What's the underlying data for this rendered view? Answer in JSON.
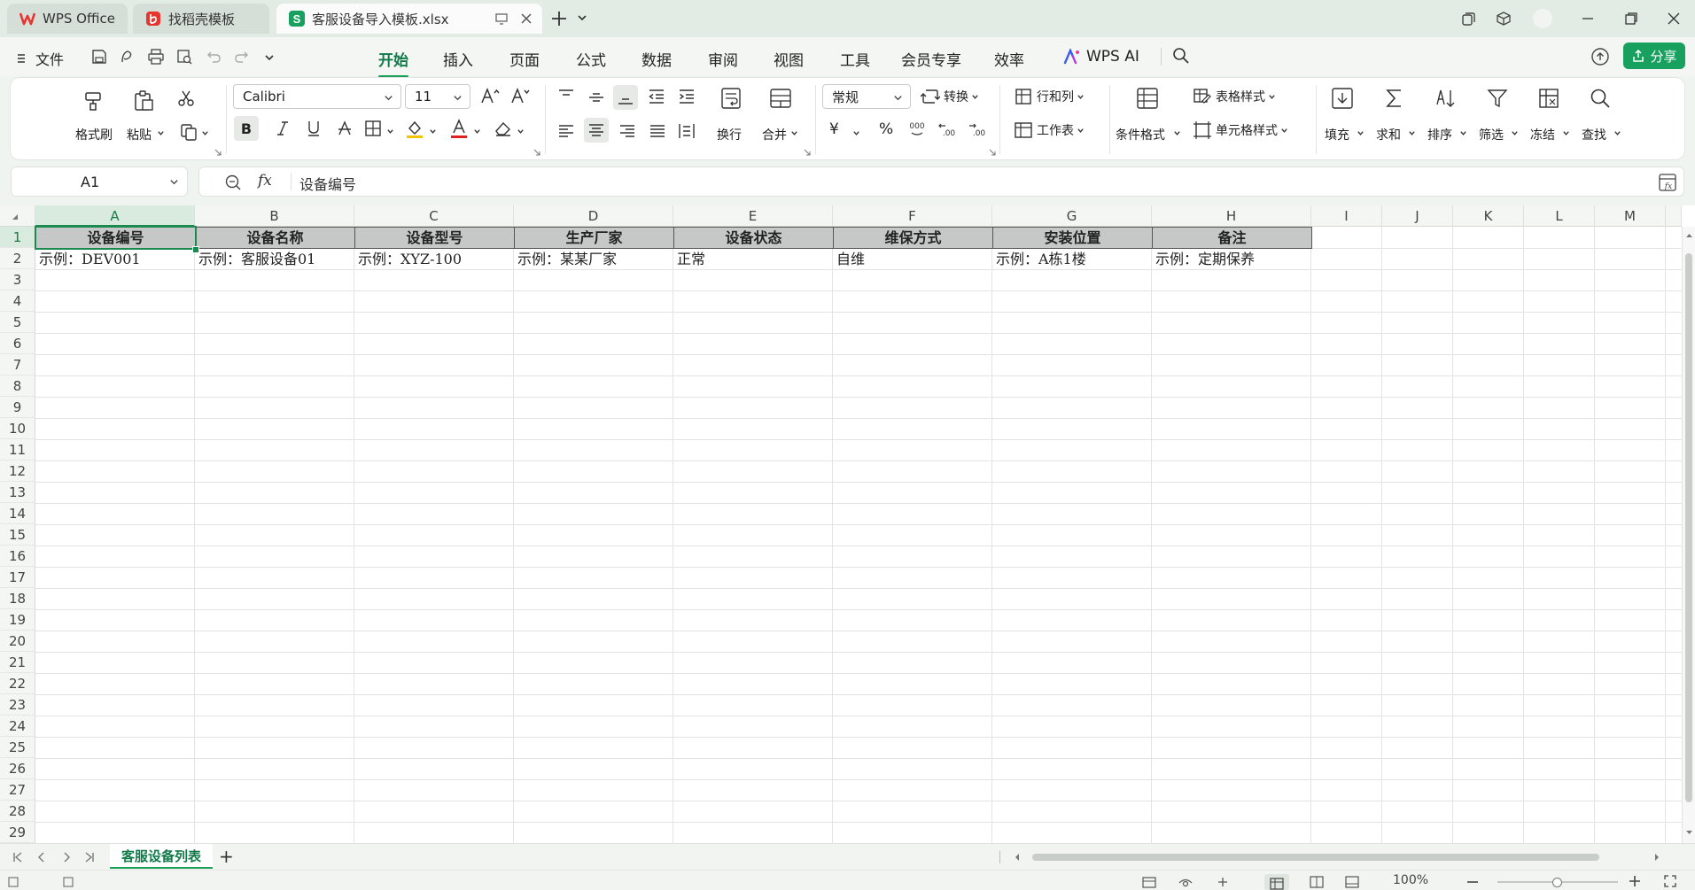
{
  "titlebar": {
    "tabs": [
      {
        "label": "WPS Office"
      },
      {
        "label": "找稻壳模板"
      },
      {
        "label": "客服设备导入模板.xlsx"
      }
    ]
  },
  "menu": {
    "file_label": "文件",
    "tabs": [
      "开始",
      "插入",
      "页面",
      "公式",
      "数据",
      "审阅",
      "视图",
      "工具",
      "会员专享",
      "效率",
      "WPS AI"
    ],
    "active_tab": "开始",
    "share_label": "分享"
  },
  "ribbon": {
    "format_painter": "格式刷",
    "paste": "粘贴",
    "font_name": "Calibri",
    "font_size": "11",
    "wrap": "换行",
    "merge": "合并",
    "number_format": "常规",
    "convert": "转换",
    "row_col": "行和列",
    "worksheet": "工作表",
    "cond_format": "条件格式",
    "table_style": "表格样式",
    "cell_style": "单元格样式",
    "fill": "填充",
    "sum": "求和",
    "sort": "排序",
    "filter": "筛选",
    "freeze": "冻结",
    "find": "查找",
    "currency_symbol": "¥",
    "percent_symbol": "%"
  },
  "formula_bar": {
    "cell_ref": "A1",
    "fx": "fx",
    "content": "设备编号"
  },
  "sheet": {
    "columns": [
      "A",
      "B",
      "C",
      "D",
      "E",
      "F",
      "G",
      "H",
      "I",
      "J",
      "K",
      "L",
      "M"
    ],
    "rows": [
      "1",
      "2",
      "3",
      "4",
      "5",
      "6",
      "7",
      "8",
      "9",
      "10",
      "11",
      "12",
      "13",
      "14",
      "15",
      "16",
      "17",
      "18",
      "19",
      "20",
      "21",
      "22",
      "23",
      "24",
      "25",
      "26",
      "27",
      "28",
      "29"
    ],
    "header_cells": [
      "设备编号",
      "设备名称",
      "设备型号",
      "生产厂家",
      "设备状态",
      "维保方式",
      "安装位置",
      "备注"
    ],
    "row2_cells": [
      "示例：DEV001",
      "示例：客服设备01",
      "示例：XYZ-100",
      "示例：某某厂家",
      "正常",
      "自维",
      "示例：A栋1楼",
      "示例：定期保养"
    ]
  },
  "sheet_tabs": {
    "active_sheet": "客服设备列表",
    "add": "+"
  },
  "status": {
    "zoom": "100%"
  },
  "colors": {
    "accent": "#18a058",
    "header_fill": "#c5c8c6",
    "wps_red": "#e8342e"
  }
}
